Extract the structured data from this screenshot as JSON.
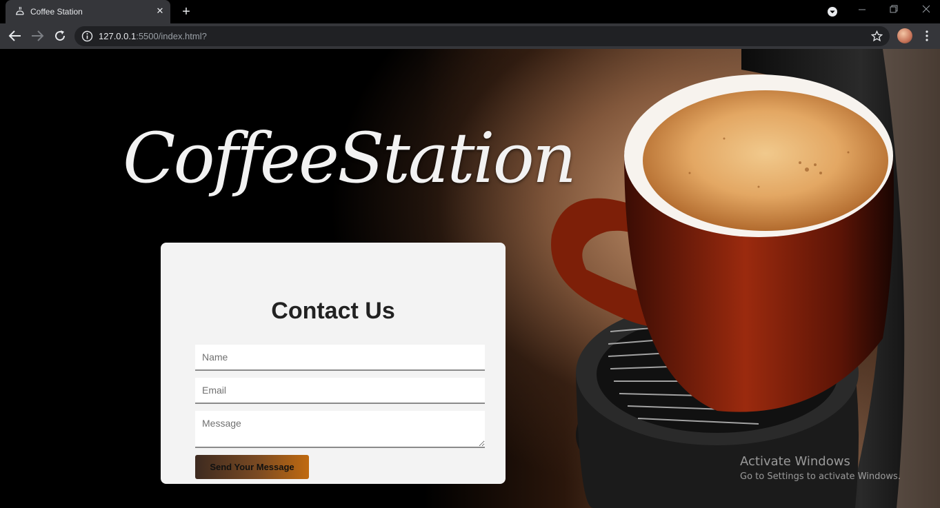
{
  "browser": {
    "tab_title": "Coffee Station",
    "url_host": "127.0.0.1",
    "url_rest": ":5500/index.html?"
  },
  "hero": {
    "brand": "CoffeeStation"
  },
  "contact": {
    "title": "Contact Us",
    "name_placeholder": "Name",
    "email_placeholder": "Email",
    "message_placeholder": "Message",
    "submit_label": "Send Your Message"
  },
  "watermark": {
    "title": "Activate Windows",
    "subtitle": "Go to Settings to activate Windows."
  },
  "colors": {
    "chrome_dark": "#000000",
    "chrome_tab": "#35363a",
    "card_bg": "#f3f3f3",
    "button_start": "#3d2a20",
    "button_end": "#c06a10"
  },
  "icons": [
    "coffee-favicon-icon",
    "close-icon",
    "plus-icon",
    "tab-search-icon",
    "minimize-icon",
    "restore-icon",
    "window-close-icon",
    "back-icon",
    "forward-icon",
    "reload-icon",
    "info-icon",
    "star-icon",
    "menu-icon"
  ]
}
